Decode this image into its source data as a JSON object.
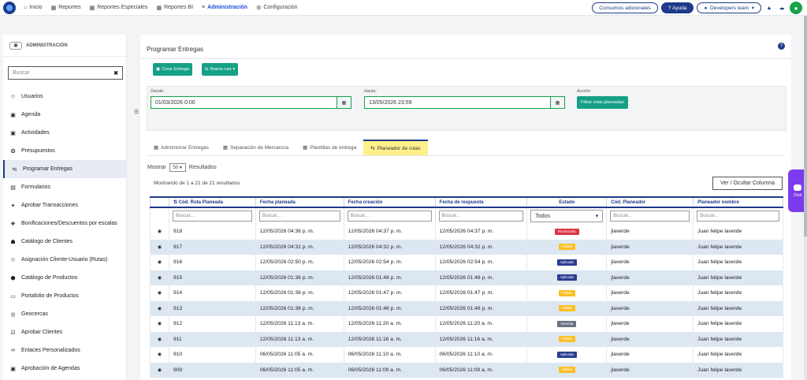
{
  "topnav": {
    "items": [
      {
        "icon": "home-icon",
        "glyph": "⌂",
        "label": "Inicio"
      },
      {
        "icon": "grid-icon",
        "glyph": "▦",
        "label": "Reportes"
      },
      {
        "icon": "grid-icon",
        "glyph": "▦",
        "label": "Reportes Especiales"
      },
      {
        "icon": "grid-icon",
        "glyph": "▦",
        "label": "Reportes BI"
      },
      {
        "icon": "sliders-icon",
        "glyph": "≡",
        "label": "Administración"
      },
      {
        "icon": "gear-icon",
        "glyph": "⚙",
        "label": "Configuración"
      }
    ],
    "consumos": "Consumos adicionales",
    "ayuda": "Ayuda",
    "team": "Developers team"
  },
  "sidebar": {
    "header": "ADMINISTRACIÓN",
    "search_placeholder": "Buscar",
    "items": [
      {
        "icon": "user-icon",
        "glyph": "☺",
        "label": "Usuarios"
      },
      {
        "icon": "calendar-icon",
        "glyph": "▣",
        "label": "Agenda"
      },
      {
        "icon": "calendar-icon",
        "glyph": "▣",
        "label": "Actividades"
      },
      {
        "icon": "trophy-icon",
        "glyph": "❂",
        "label": "Presupuestos"
      },
      {
        "icon": "route-icon",
        "glyph": "⇆",
        "label": "Programar Entregas"
      },
      {
        "icon": "form-icon",
        "glyph": "▤",
        "label": "Formularios"
      },
      {
        "icon": "handshake-icon",
        "glyph": "✦",
        "label": "Aprobar Transacciones"
      },
      {
        "icon": "gift-icon",
        "glyph": "❖",
        "label": "Bonificaciones/Descuentos por escalas"
      },
      {
        "icon": "catalog-icon",
        "glyph": "☗",
        "label": "Catálogo de Clientes"
      },
      {
        "icon": "binoculars-icon",
        "glyph": "☉",
        "label": "Asignación Cliente-Usuario (Rutas)"
      },
      {
        "icon": "cubes-icon",
        "glyph": "⬢",
        "label": "Catálogo de Productos"
      },
      {
        "icon": "folder-icon",
        "glyph": "▭",
        "label": "Portafolio de Productos"
      },
      {
        "icon": "globe-icon",
        "glyph": "◎",
        "label": "Geocercas"
      },
      {
        "icon": "check-square-icon",
        "glyph": "☑",
        "label": "Aprobar Clientes"
      },
      {
        "icon": "link-icon",
        "glyph": "∞",
        "label": "Enlaces Personalizados"
      },
      {
        "icon": "calendar-check-icon",
        "glyph": "▣",
        "label": "Aprobación de Agendas"
      }
    ]
  },
  "main": {
    "title": "Programar Entregas",
    "crear": "Crear Entrega",
    "nueva": "Nueva ruta",
    "desde_label": "Desde:",
    "desde_value": "01/03/2026 0:00",
    "hasta_label": "Hasta:",
    "hasta_value": "13/05/2026 23:59",
    "accion_label": "Acción:",
    "filtrar": "Filtrar rutas planeadas",
    "tabs": [
      {
        "icon": "table-icon",
        "label": "Administrar Entregas"
      },
      {
        "icon": "table-icon",
        "label": "Separación de Mercancía"
      },
      {
        "icon": "table-icon",
        "label": "Plantillas de entrega"
      },
      {
        "icon": "route-icon",
        "label": "Planeador de rutas"
      }
    ],
    "mostrar": "Mostrar",
    "page_size": "50",
    "resultados": "Resultados",
    "summary": "Mostrando de 1 a 21 de 21 resultados",
    "toggle_cols": "Ver / Ocultar Columna"
  },
  "table": {
    "headers": [
      "",
      "Cód. Ruta Planeada",
      "Fecha planeada",
      "Fecha creación",
      "Fecha de respuesta",
      "Estado",
      "Cód. Planeador",
      "Planeador nombre"
    ],
    "filter_placeholder": "Buscar...",
    "estado_filter": "Todos",
    "rows": [
      {
        "id": "918",
        "planeada": "12/05/2026 04:36 p. m.",
        "creacion": "12/05/2026 04:37 p. m.",
        "respuesta": "12/05/2026 04:37 p. m.",
        "estado": "Rechazado",
        "color": "#dc3545",
        "cod": "jlaverde",
        "nombre": "Juan felipe laverde"
      },
      {
        "id": "917",
        "planeada": "12/05/2026 04:31 p. m.",
        "creacion": "12/05/2026 04:32 p. m.",
        "respuesta": "12/05/2026 04:32 p. m.",
        "estado": "Fallida",
        "color": "#fbbf24",
        "cod": "jlaverde",
        "nombre": "Juan felipe laverde"
      },
      {
        "id": "916",
        "planeada": "12/05/2026 02:50 p. m.",
        "creacion": "12/05/2026 02:54 p. m.",
        "respuesta": "12/05/2026 02:54 p. m.",
        "estado": "Aplicada",
        "color": "#2b3d8f",
        "cod": "jlaverde",
        "nombre": "Juan felipe laverde"
      },
      {
        "id": "915",
        "planeada": "12/05/2026 01:36 p. m.",
        "creacion": "12/05/2026 01:48 p. m.",
        "respuesta": "12/05/2026 01:48 p. m.",
        "estado": "Aplicada",
        "color": "#2b3d8f",
        "cod": "jlaverde",
        "nombre": "Juan felipe laverde"
      },
      {
        "id": "914",
        "planeada": "12/05/2026 01:36 p. m.",
        "creacion": "12/05/2026 01:47 p. m.",
        "respuesta": "12/05/2026 01:47 p. m.",
        "estado": "Fallida",
        "color": "#fbbf24",
        "cod": "jlaverde",
        "nombre": "Juan felipe laverde"
      },
      {
        "id": "913",
        "planeada": "12/05/2026 01:36 p. m.",
        "creacion": "12/05/2026 01:46 p. m.",
        "respuesta": "12/05/2026 01:46 p. m.",
        "estado": "Fallida",
        "color": "#fbbf24",
        "cod": "jlaverde",
        "nombre": "Juan felipe laverde"
      },
      {
        "id": "912",
        "planeada": "12/05/2026 11:13 a. m.",
        "creacion": "12/05/2026 11:20 a. m.",
        "respuesta": "12/05/2026 11:20 a. m.",
        "estado": "Vencida",
        "color": "#6b7280",
        "cod": "jlaverde",
        "nombre": "Juan felipe laverde"
      },
      {
        "id": "911",
        "planeada": "12/05/2026 11:13 a. m.",
        "creacion": "12/05/2026 11:16 a. m.",
        "respuesta": "12/05/2026 11:16 a. m.",
        "estado": "Fallida",
        "color": "#fbbf24",
        "cod": "jlaverde",
        "nombre": "Juan felipe laverde"
      },
      {
        "id": "910",
        "planeada": "06/05/2026 11:05 a. m.",
        "creacion": "06/05/2026 11:10 a. m.",
        "respuesta": "06/05/2026 11:10 a. m.",
        "estado": "Aplicada",
        "color": "#2b3d8f",
        "cod": "jlaverde",
        "nombre": "Juan felipe laverde"
      },
      {
        "id": "909",
        "planeada": "06/05/2026 11:05 a. m.",
        "creacion": "06/05/2026 11:09 a. m.",
        "respuesta": "06/05/2026 11:09 a. m.",
        "estado": "Fallida",
        "color": "#fbbf24",
        "cod": "jlaverde",
        "nombre": "Juan felipe laverde"
      }
    ]
  },
  "chat_label": "Chat"
}
